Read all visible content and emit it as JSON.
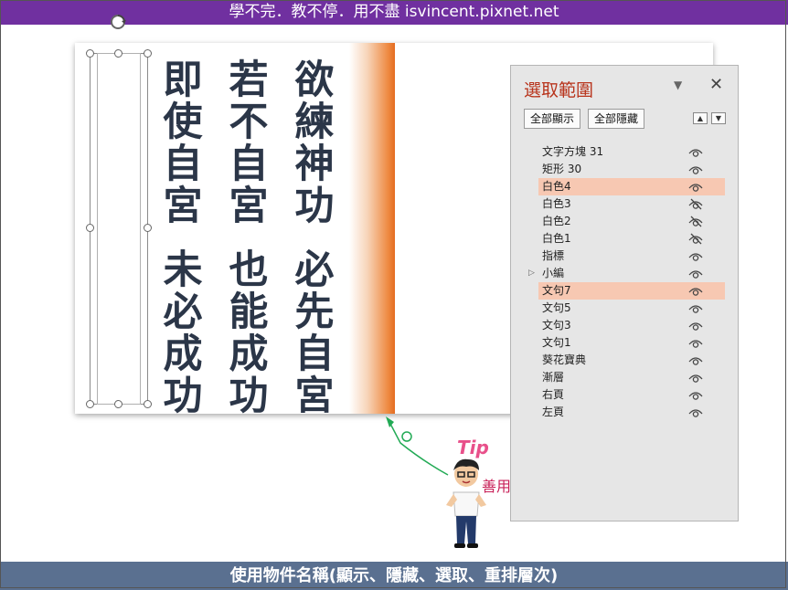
{
  "header": {
    "title": "學不完．教不停．用不盡 isvincent.pixnet.net"
  },
  "footer": {
    "caption": "使用物件名稱(顯示、隱藏、選取、重排層次)"
  },
  "slide": {
    "columns": [
      {
        "top": "欲練神功",
        "bottom": "必先自宮"
      },
      {
        "top": "若不自宮",
        "bottom": "也能成功"
      },
      {
        "top": "即使自宮",
        "bottom": "未必成功"
      }
    ]
  },
  "selection_pane": {
    "title": "選取範圍",
    "show_all_label": "全部顯示",
    "hide_all_label": "全部隱藏",
    "items": [
      {
        "label": "文字方塊 31",
        "visible": true,
        "selected": false
      },
      {
        "label": "矩形 30",
        "visible": true,
        "selected": false
      },
      {
        "label": "白色4",
        "visible": true,
        "selected": true
      },
      {
        "label": "白色3",
        "visible": false,
        "selected": false
      },
      {
        "label": "白色2",
        "visible": false,
        "selected": false
      },
      {
        "label": "白色1",
        "visible": false,
        "selected": false
      },
      {
        "label": "指標",
        "visible": true,
        "selected": false
      },
      {
        "label": "小編",
        "visible": true,
        "selected": false,
        "group": true
      },
      {
        "label": "文句7",
        "visible": true,
        "selected": true
      },
      {
        "label": "文句5",
        "visible": true,
        "selected": false
      },
      {
        "label": "文句3",
        "visible": true,
        "selected": false
      },
      {
        "label": "文句1",
        "visible": true,
        "selected": false
      },
      {
        "label": "葵花寶典",
        "visible": true,
        "selected": false
      },
      {
        "label": "漸層",
        "visible": true,
        "selected": false
      },
      {
        "label": "右頁",
        "visible": true,
        "selected": false
      },
      {
        "label": "左頁",
        "visible": true,
        "selected": false
      }
    ]
  },
  "mascot": {
    "tip": "Tip",
    "caption": "善用"
  },
  "colors": {
    "header_bg": "#7030a0",
    "footer_bg": "#5a7090",
    "selected_row": "#f7c8b2",
    "pane_title": "#b8341c",
    "text_dark": "#2b3648",
    "accent_orange": "#e46c20"
  }
}
